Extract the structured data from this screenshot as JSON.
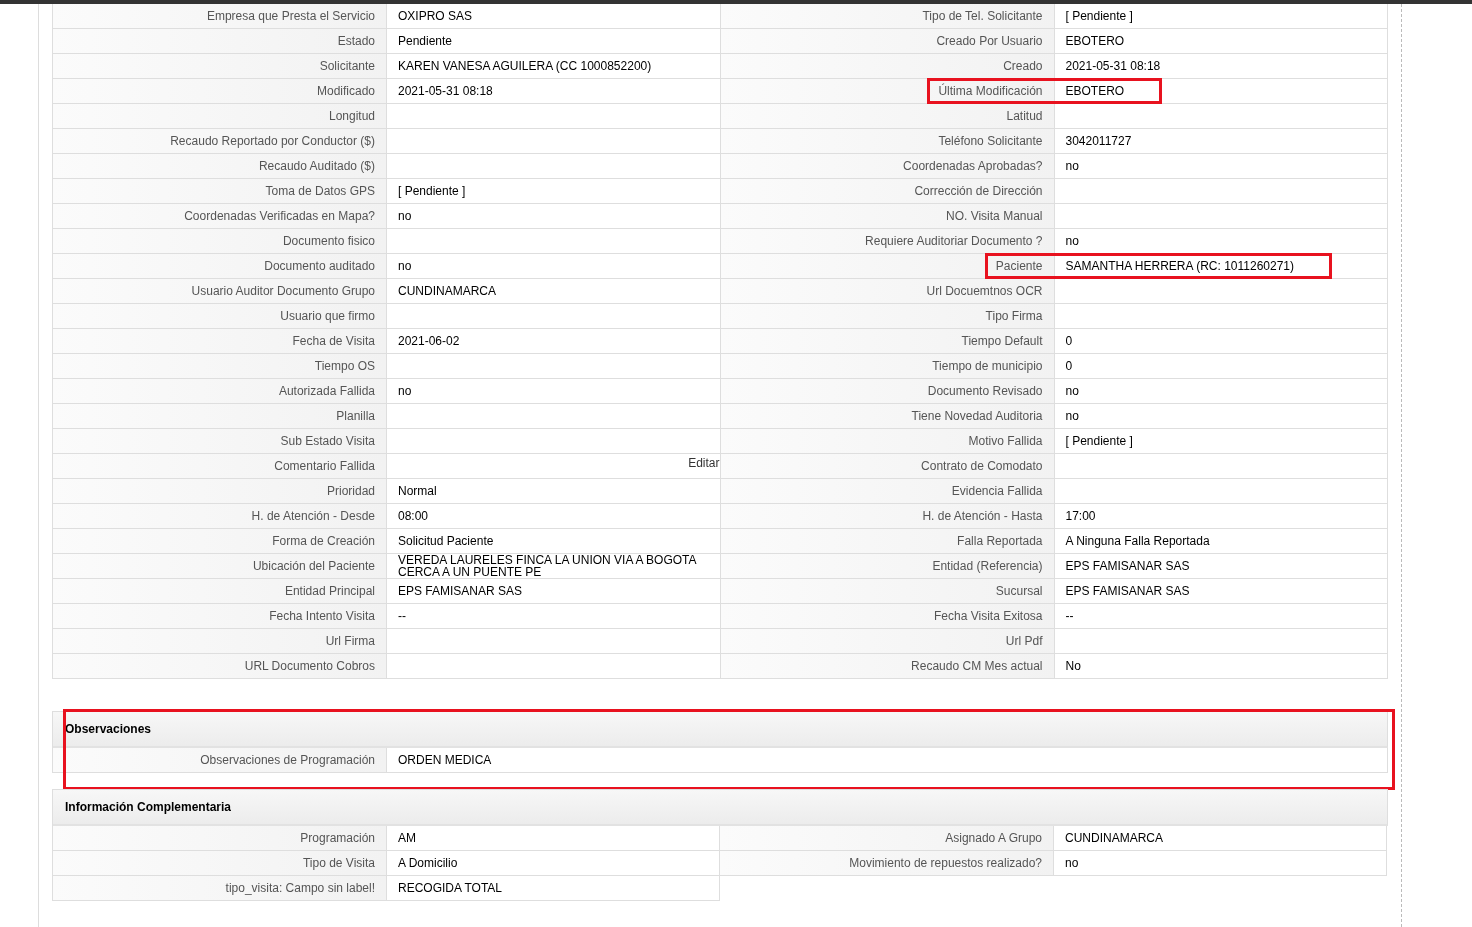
{
  "detail_rows": [
    [
      {
        "label": "Empresa que Presta el Servicio",
        "value": "OXIPRO SAS",
        "highlighted": false
      },
      {
        "label": "Tipo de Tel. Solicitante",
        "value": "[ Pendiente ]",
        "highlighted": false
      }
    ],
    [
      {
        "label": "Estado",
        "value": "Pendiente",
        "highlighted": false
      },
      {
        "label": "Creado Por Usuario",
        "value": "EBOTERO",
        "highlighted": false
      }
    ],
    [
      {
        "label": "Solicitante",
        "value": "KAREN VANESA AGUILERA (CC 1000852200)",
        "highlighted": false
      },
      {
        "label": "Creado",
        "value": "2021-05-31 08:18",
        "highlighted": false
      }
    ],
    [
      {
        "label": "Modificado",
        "value": "2021-05-31 08:18",
        "highlighted": false
      },
      {
        "label": "Última Modificación",
        "value": "EBOTERO",
        "highlighted": true
      }
    ],
    [
      {
        "label": "Longitud",
        "highlighted": false
      },
      {
        "label": "Latitud",
        "highlighted": false
      }
    ],
    [
      {
        "label": "Recaudo Reportado por Conductor ($)",
        "highlighted": false
      },
      {
        "label": "Teléfono Solicitante",
        "value": "3042011727",
        "highlighted": false
      }
    ],
    [
      {
        "label": "Recaudo Auditado ($)",
        "highlighted": false
      },
      {
        "label": "Coordenadas Aprobadas?",
        "value": "no",
        "highlighted": false
      }
    ],
    [
      {
        "label": "Toma de Datos GPS",
        "value": "[ Pendiente ]",
        "highlighted": false
      },
      {
        "label": "Corrección de Dirección",
        "highlighted": false
      }
    ],
    [
      {
        "label": "Coordenadas Verificadas en Mapa?",
        "value": "no",
        "highlighted": false
      },
      {
        "label": "NO. Visita Manual",
        "highlighted": false
      }
    ],
    [
      {
        "label": "Documento fisico",
        "highlighted": false
      },
      {
        "label": "Requiere Auditoriar Documento ?",
        "value": "no",
        "highlighted": false
      }
    ],
    [
      {
        "label": "Documento auditado",
        "value": "no",
        "highlighted": false
      },
      {
        "label": "Paciente",
        "value": "SAMANTHA HERRERA (RC: 1011260271)",
        "highlighted": true
      }
    ],
    [
      {
        "label": "Usuario Auditor Documento Grupo",
        "value": "CUNDINAMARCA",
        "highlighted": false
      },
      {
        "label": "Url Docuemtnos OCR",
        "highlighted": false
      }
    ],
    [
      {
        "label": "Usuario que firmo",
        "highlighted": false
      },
      {
        "label": "Tipo Firma",
        "highlighted": false
      }
    ],
    [
      {
        "label": "Fecha de Visita",
        "value": "2021-06-02",
        "highlighted": false
      },
      {
        "label": "Tiempo Default",
        "value": "0",
        "highlighted": false
      }
    ],
    [
      {
        "label": "Tiempo OS",
        "highlighted": false
      },
      {
        "label": "Tiempo de municipio",
        "value": "0",
        "highlighted": false
      }
    ],
    [
      {
        "label": "Autorizada Fallida",
        "value": "no",
        "highlighted": false
      },
      {
        "label": "Documento Revisado",
        "value": "no",
        "highlighted": false
      }
    ],
    [
      {
        "label": "Planilla",
        "highlighted": false
      },
      {
        "label": "Tiene Novedad Auditoria",
        "value": "no",
        "highlighted": false
      }
    ],
    [
      {
        "label": "Sub Estado Visita",
        "highlighted": false
      },
      {
        "label": "Motivo Fallida",
        "value": "[ Pendiente ]",
        "highlighted": false
      }
    ],
    [
      {
        "label": "Comentario Fallida",
        "action": "Editar",
        "highlighted": false
      },
      {
        "label": "Contrato de Comodato",
        "highlighted": false
      }
    ],
    [
      {
        "label": "Prioridad",
        "value": "Normal",
        "highlighted": false
      },
      {
        "label": "Evidencia Fallida",
        "highlighted": false
      }
    ],
    [
      {
        "label": "H. de Atención - Desde",
        "value": "08:00",
        "highlighted": false
      },
      {
        "label": "H. de Atención - Hasta",
        "value": "17:00",
        "highlighted": false
      }
    ],
    [
      {
        "label": "Forma de Creación",
        "value": "Solicitud Paciente",
        "highlighted": false
      },
      {
        "label": "Falla Reportada",
        "value": "A Ninguna Falla Reportada",
        "highlighted": false
      }
    ],
    [
      {
        "label": "Ubicación del Paciente",
        "value": "VEREDA LAURELES FINCA LA UNION VIA A BOGOTA CERCA A UN PUENTE PE",
        "highlighted": false
      },
      {
        "label": "Entidad (Referencia)",
        "value": "EPS FAMISANAR SAS",
        "highlighted": false
      }
    ],
    [
      {
        "label": "Entidad Principal",
        "value": "EPS FAMISANAR SAS",
        "highlighted": false
      },
      {
        "label": "Sucursal",
        "value": "EPS FAMISANAR SAS",
        "highlighted": false
      }
    ],
    [
      {
        "label": "Fecha Intento Visita",
        "value": "--",
        "highlighted": false
      },
      {
        "label": "Fecha Visita Exitosa",
        "value": "--",
        "highlighted": false
      }
    ],
    [
      {
        "label": "Url Firma",
        "highlighted": false
      },
      {
        "label": "Url Pdf",
        "highlighted": false
      }
    ],
    [
      {
        "label": "URL Documento Cobros",
        "highlighted": false
      },
      {
        "label": "Recaudo CM Mes actual",
        "value": "No",
        "highlighted": false
      }
    ]
  ],
  "panels": [
    {
      "title": "Observaciones",
      "highlighted": true,
      "kind": "full",
      "rows": [
        [
          {
            "label": "Observaciones de Programación",
            "value": "ORDEN MEDICA"
          }
        ]
      ]
    },
    {
      "title": "Información Complementaria",
      "highlighted": false,
      "kind": "pairs",
      "rows": [
        [
          {
            "label": "Programación",
            "value": "AM"
          },
          {
            "label": "Asignado A Grupo",
            "value": "CUNDINAMARCA"
          }
        ],
        [
          {
            "label": "Tipo de Visita",
            "value": "A Domicilio"
          },
          {
            "label": "Movimiento de repuestos realizado?",
            "value": "no"
          }
        ],
        [
          {
            "label": "tipo_visita: Campo sin label!",
            "value": "RECOGIDA TOTAL"
          }
        ]
      ]
    }
  ]
}
